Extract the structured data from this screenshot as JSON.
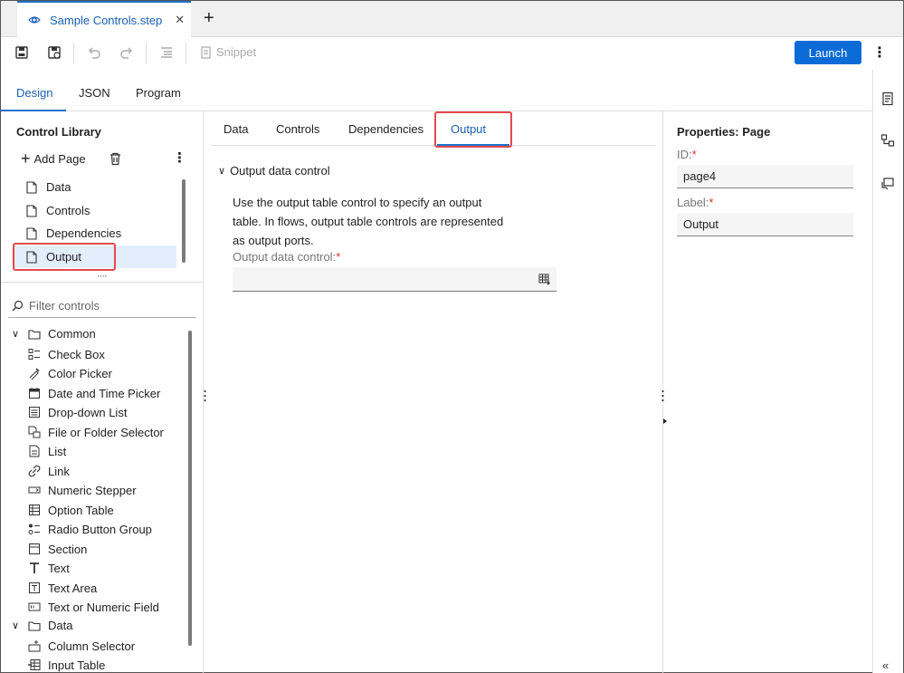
{
  "tabbar": {
    "file_tab_label": "Sample Controls.step",
    "close_glyph": "✕",
    "new_tab_glyph": "+"
  },
  "toolbar": {
    "snippet_label": "Snippet",
    "launch_label": "Launch",
    "more_glyph": "⋮",
    "icons": [
      "save-icon",
      "save-as-icon",
      "undo-icon",
      "redo-icon",
      "format-icon",
      "snippet-icon"
    ]
  },
  "mode_tabs": [
    {
      "label": "Design",
      "active": true
    },
    {
      "label": "JSON",
      "active": false
    },
    {
      "label": "Program",
      "active": false
    }
  ],
  "control_library": {
    "title": "Control Library",
    "add_page_label": "Add Page",
    "pages": [
      {
        "label": "Data",
        "selected": false
      },
      {
        "label": "Controls",
        "selected": false
      },
      {
        "label": "Dependencies",
        "selected": false
      },
      {
        "label": "Output",
        "selected": true
      }
    ],
    "filter_placeholder": "Filter controls",
    "groups": [
      {
        "label": "Common",
        "items": [
          {
            "label": "Check Box",
            "icon": "checkbox-icon"
          },
          {
            "label": "Color Picker",
            "icon": "color-picker-icon"
          },
          {
            "label": "Date and Time Picker",
            "icon": "calendar-icon"
          },
          {
            "label": "Drop-down List",
            "icon": "dropdown-list-icon"
          },
          {
            "label": "File or Folder Selector",
            "icon": "file-folder-icon"
          },
          {
            "label": "List",
            "icon": "list-icon"
          },
          {
            "label": "Link",
            "icon": "link-icon"
          },
          {
            "label": "Numeric Stepper",
            "icon": "numeric-stepper-icon"
          },
          {
            "label": "Option Table",
            "icon": "option-table-icon"
          },
          {
            "label": "Radio Button Group",
            "icon": "radio-group-icon"
          },
          {
            "label": "Section",
            "icon": "section-icon"
          },
          {
            "label": "Text",
            "icon": "text-icon"
          },
          {
            "label": "Text Area",
            "icon": "text-area-icon"
          },
          {
            "label": "Text or Numeric Field",
            "icon": "text-field-icon"
          }
        ]
      },
      {
        "label": "Data",
        "items": [
          {
            "label": "Column Selector",
            "icon": "column-selector-icon"
          },
          {
            "label": "Input Table",
            "icon": "input-table-icon"
          }
        ]
      }
    ]
  },
  "editor": {
    "subtabs": [
      {
        "label": "Data",
        "active": false
      },
      {
        "label": "Controls",
        "active": false
      },
      {
        "label": "Dependencies",
        "active": false
      },
      {
        "label": "Output",
        "active": true
      }
    ],
    "control_header": "Output data control",
    "description": "Use the output table control to specify an output table. In flows, output table controls are represented as output ports.",
    "field_label": "Output data control:",
    "field_required": "*",
    "field_value": ""
  },
  "properties": {
    "title": "Properties: Page",
    "id_label": "ID:",
    "id_value": "page4",
    "label_label": "Label:",
    "label_value": "Output",
    "required_mark": "*"
  },
  "rail": {
    "icons": [
      "properties-icon",
      "flow-icon",
      "comment-icon"
    ],
    "collapse_glyph": "«"
  },
  "colors": {
    "accent": "#1a73c8",
    "launch": "#0b6bd6",
    "highlight_box": "#e5484d",
    "selected_bg": "#e3eefc"
  }
}
